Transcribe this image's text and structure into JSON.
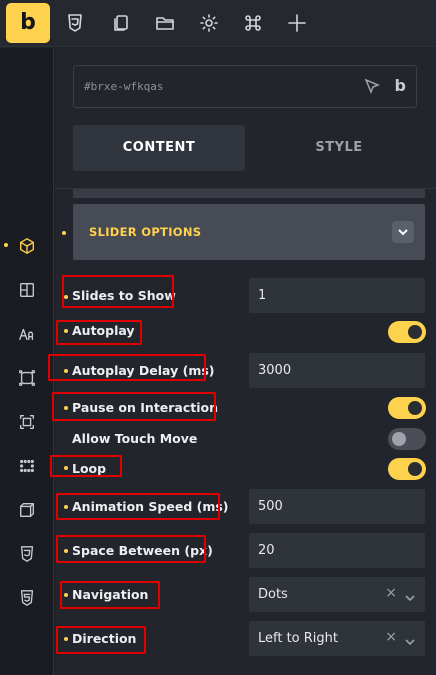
{
  "toolbar": {
    "logo": "b",
    "icons": [
      "css3-icon",
      "copy-icon",
      "folder-icon",
      "gear-icon",
      "command-icon",
      "plus-icon"
    ]
  },
  "sidebar": {
    "items": [
      "cube-icon",
      "layout-icon",
      "typography-icon",
      "border-effects-icon",
      "spacing-icon",
      "grid-dots-icon",
      "transform-icon",
      "css3-icon",
      "html5-icon"
    ]
  },
  "element": {
    "id": "#brxe-wfkqas",
    "b_label": "b"
  },
  "tabs": {
    "content": "CONTENT",
    "style": "STYLE"
  },
  "section": {
    "title": "SLIDER OPTIONS"
  },
  "controls": [
    {
      "label": "Slides to Show",
      "type": "number",
      "value": "1"
    },
    {
      "label": "Autoplay",
      "type": "toggle",
      "state": "on"
    },
    {
      "label": "Autoplay Delay (ms)",
      "type": "number",
      "value": "3000"
    },
    {
      "label": "Pause on Interaction",
      "type": "toggle",
      "state": "on"
    },
    {
      "label": "Allow Touch Move",
      "type": "toggle",
      "state": "off"
    },
    {
      "label": "Loop",
      "type": "toggle",
      "state": "on"
    },
    {
      "label": "Animation Speed (ms)",
      "type": "number",
      "value": "500"
    },
    {
      "label": "Space Between (px)",
      "type": "number",
      "value": "20"
    },
    {
      "label": "Navigation",
      "type": "select",
      "value": "Dots",
      "clear": "×"
    },
    {
      "label": "Direction",
      "type": "select",
      "value": "Left to Right",
      "clear": "×"
    }
  ],
  "colors": {
    "accent": "#ffd24d",
    "highlight": "#e10000",
    "panel": "#22252b"
  }
}
